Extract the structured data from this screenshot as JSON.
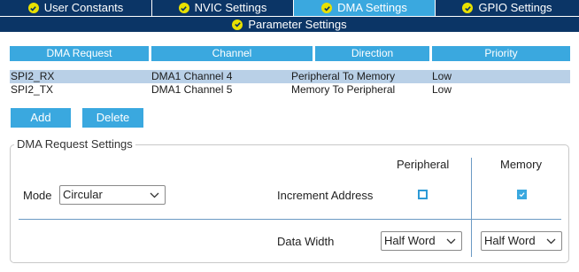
{
  "tabs": {
    "row1": [
      {
        "label": "User Constants"
      },
      {
        "label": "NVIC Settings"
      },
      {
        "label": "DMA Settings"
      },
      {
        "label": "GPIO Settings"
      }
    ],
    "row2": {
      "label": "Parameter Settings"
    },
    "active": "DMA Settings"
  },
  "table": {
    "headers": [
      "DMA Request",
      "Channel",
      "Direction",
      "Priority"
    ],
    "rows": [
      {
        "request": "SPI2_RX",
        "channel": "DMA1 Channel 4",
        "direction": "Peripheral To Memory",
        "priority": "Low",
        "selected": true
      },
      {
        "request": "SPI2_TX",
        "channel": "DMA1 Channel 5",
        "direction": "Memory To Peripheral",
        "priority": "Low",
        "selected": false
      }
    ]
  },
  "buttons": {
    "add": "Add",
    "delete": "Delete"
  },
  "settings": {
    "title": "DMA Request Settings",
    "mode_label": "Mode",
    "mode_value": "Circular",
    "peripheral_label": "Peripheral",
    "memory_label": "Memory",
    "increment_label": "Increment Address",
    "peripheral_increment": false,
    "memory_increment": true,
    "data_width_label": "Data Width",
    "peripheral_width": "Half Word",
    "memory_width": "Half Word"
  },
  "colors": {
    "tab_bar": "#0b3566",
    "accent": "#3aa8df",
    "check_icon": "#e8e100",
    "selected_row": "#b9d0e7"
  }
}
